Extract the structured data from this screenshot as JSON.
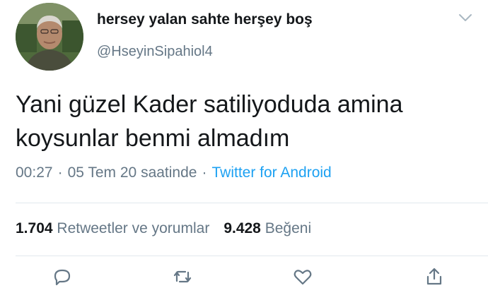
{
  "user": {
    "display_name": "hersey yalan sahte herşey boş",
    "handle": "@HseyinSipahiol4"
  },
  "tweet": {
    "text": "Yani güzel Kader satiliyoduda amina koysunlar benmi almadım",
    "time": "00:27",
    "date": "05 Tem 20 saatinde",
    "separator": "·",
    "source": "Twitter for Android"
  },
  "stats": {
    "retweets_count": "1.704",
    "retweets_label": "Retweetler ve yorumlar",
    "likes_count": "9.428",
    "likes_label": "Beğeni"
  },
  "icons": {
    "menu": "chevron-down-icon",
    "actions": [
      "reply-icon",
      "retweet-icon",
      "like-icon",
      "share-icon"
    ]
  },
  "colors": {
    "text": "#14171a",
    "secondary": "#657786",
    "link": "#1da1f2",
    "divider": "#e1e8ed"
  }
}
